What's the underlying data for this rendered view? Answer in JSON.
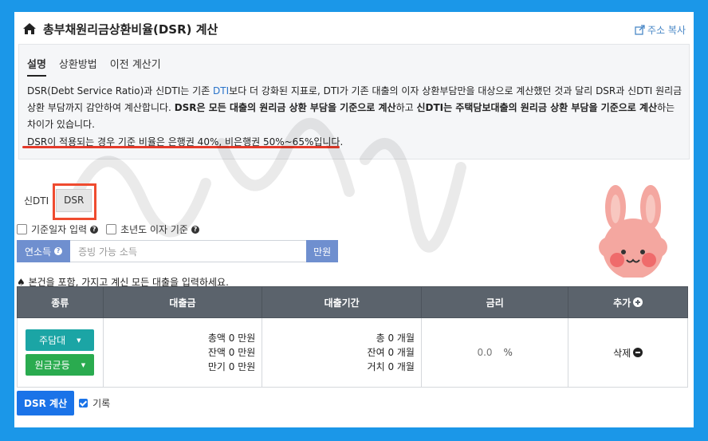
{
  "header": {
    "title": "총부채원리금상환비율(DSR) 계산",
    "copy_label": "주소 복사"
  },
  "info": {
    "tabs": [
      {
        "label": "설명",
        "active": true
      },
      {
        "label": "상환방법",
        "active": false
      },
      {
        "label": "이전 계산기",
        "active": false
      }
    ],
    "desc_part1": "DSR(Debt Service Ratio)과 신DTI는 기존 ",
    "desc_link": "DTI",
    "desc_part2": "보다 더 강화된 지표로, DTI가 기존 대출의 이자 상환부담만을 대상으로 계산했던 것과 달리 DSR과 신DTI 원리금 상환 부담까지 감안하여 계산합니다. ",
    "desc_bold1": "DSR은 모든 대출의 원리금 상환 부담을 기준으로 계산",
    "desc_part3": "하고 ",
    "desc_bold2": "신DTI는 주택담보대출의 원리금 상환 부담을 기준으로 계산",
    "desc_part4": "하는 차이가 있습니다.",
    "note": "DSR이 적용되는 경우 기준 비율은 은행권 40%, 비은행권 50%~65%입니다."
  },
  "modes": [
    {
      "label": "신DTI"
    },
    {
      "label": "DSR"
    }
  ],
  "options": {
    "base_date_label": "기준일자 입력",
    "year_interest_label": "초년도 이자 기준"
  },
  "income": {
    "label": "연소득",
    "placeholder": "증빙 가능 소득",
    "unit": "만원"
  },
  "instruction": "♠ 본건을 포함, 가지고 계신 모든 대출을 입력하세요.",
  "table": {
    "headers": {
      "type": "종류",
      "amount": "대출금",
      "period": "대출기간",
      "rate": "금리",
      "add": "추가"
    },
    "row": {
      "type_select": "주담대",
      "method_select": "원금균등",
      "amount_total": "총액 0 만원",
      "amount_remain": "잔액 0 만원",
      "amount_maturity": "만기 0 만원",
      "period_total": "총 0 개월",
      "period_remain": "잔여 0 개월",
      "period_grace": "거치 0 개월",
      "rate_value": "0.0",
      "rate_unit": "%",
      "delete_label": "삭제"
    }
  },
  "footer": {
    "calc_label": "DSR 계산",
    "record_label": "기록"
  },
  "colors": {
    "background": "#1b97e8",
    "accent": "#1a73e8",
    "highlight": "#ef4b2f",
    "header_bg": "#5b636c"
  }
}
